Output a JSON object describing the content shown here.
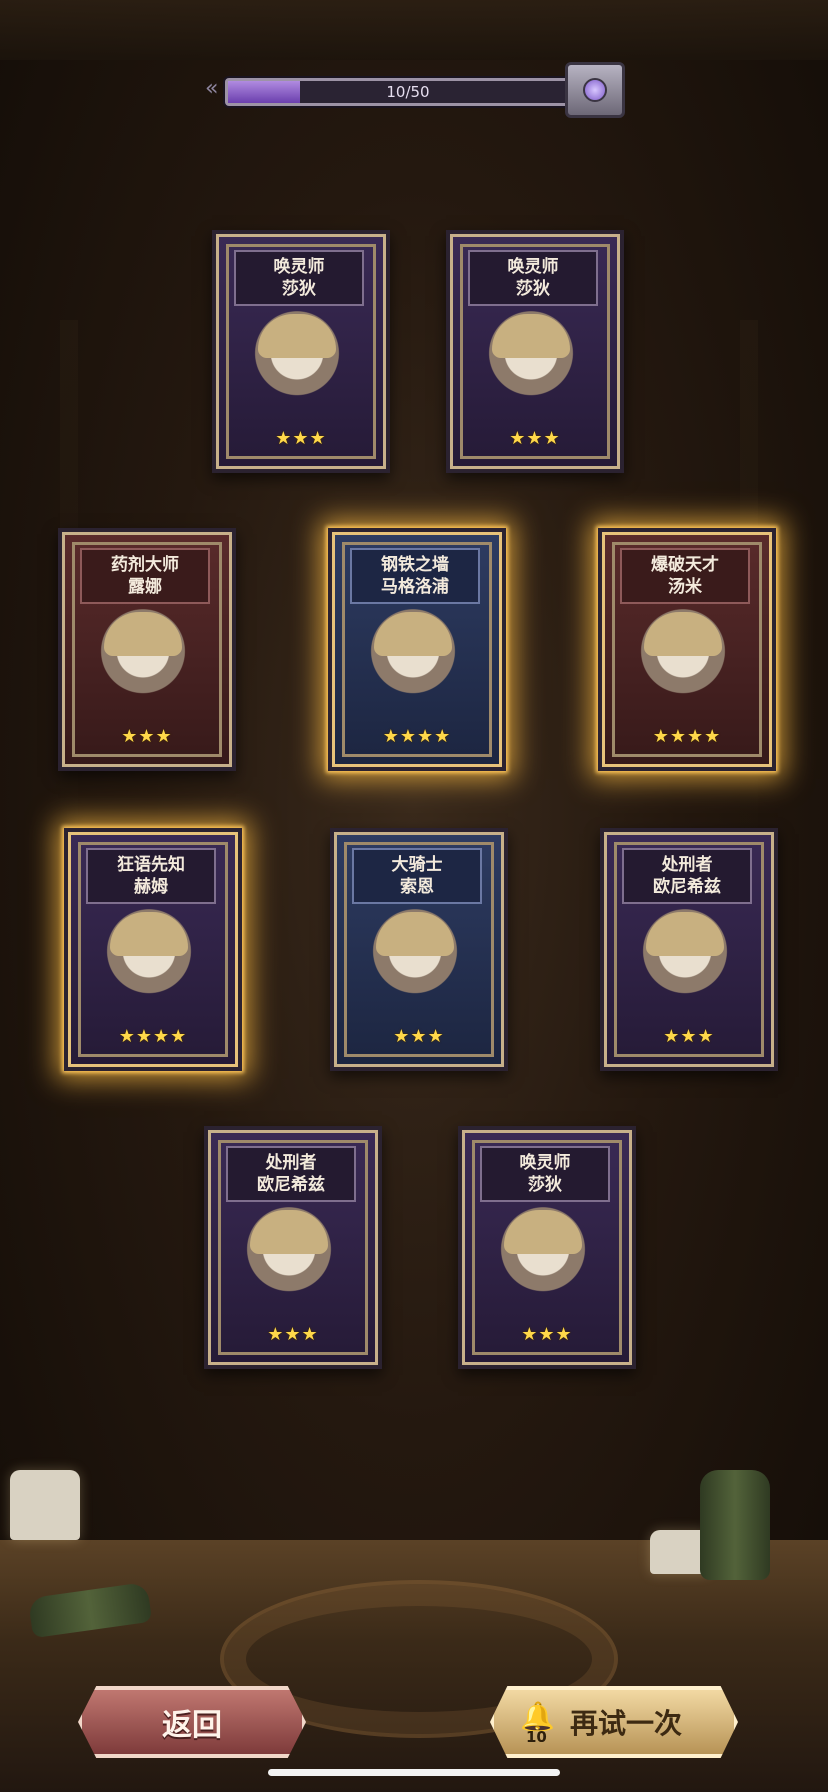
{
  "progress": {
    "text": "10/50",
    "current": 10,
    "max": 50
  },
  "cards": [
    {
      "name": "唤灵师",
      "title": "莎狄",
      "stars": "★★★",
      "rarity": 3,
      "theme": "purple",
      "glow": false
    },
    {
      "name": "唤灵师",
      "title": "莎狄",
      "stars": "★★★",
      "rarity": 3,
      "theme": "purple",
      "glow": false
    },
    {
      "name": "药剂大师",
      "title": "露娜",
      "stars": "★★★",
      "rarity": 3,
      "theme": "red",
      "glow": false
    },
    {
      "name": "钢铁之墙",
      "title": "马格洛浦",
      "stars": "★★★★",
      "rarity": 4,
      "theme": "blue",
      "glow": true
    },
    {
      "name": "爆破天才",
      "title": "汤米",
      "stars": "★★★★",
      "rarity": 4,
      "theme": "red",
      "glow": true
    },
    {
      "name": "狂语先知",
      "title": "赫姆",
      "stars": "★★★★",
      "rarity": 4,
      "theme": "purple",
      "glow": true
    },
    {
      "name": "大骑士",
      "title": "索恩",
      "stars": "★★★",
      "rarity": 3,
      "theme": "blue",
      "glow": false
    },
    {
      "name": "处刑者",
      "title": "欧尼希兹",
      "stars": "★★★",
      "rarity": 3,
      "theme": "purple",
      "glow": false
    },
    {
      "name": "处刑者",
      "title": "欧尼希兹",
      "stars": "★★★",
      "rarity": 3,
      "theme": "purple",
      "glow": false
    },
    {
      "name": "唤灵师",
      "title": "莎狄",
      "stars": "★★★",
      "rarity": 3,
      "theme": "purple",
      "glow": false
    }
  ],
  "buttons": {
    "back": "返回",
    "retry": "再试一次",
    "retry_cost": "10"
  },
  "icons": {
    "chest": "treasure-chest-icon",
    "bell": "bell-icon",
    "arrow": "double-arrow-left-icon"
  }
}
